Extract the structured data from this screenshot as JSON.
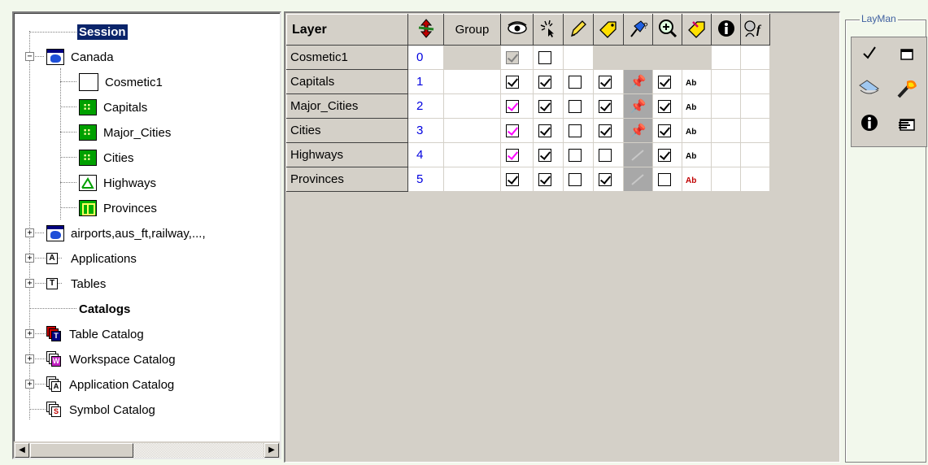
{
  "tree": {
    "nodes": [
      {
        "label": "Session",
        "kind": "session"
      },
      {
        "label": "Canada",
        "kind": "workspace"
      },
      {
        "label": "Cosmetic1",
        "kind": "cosmetic-layer"
      },
      {
        "label": "Capitals",
        "kind": "point-layer"
      },
      {
        "label": "Major_Cities",
        "kind": "point-layer"
      },
      {
        "label": "Cities",
        "kind": "point-layer"
      },
      {
        "label": "Highways",
        "kind": "line-layer"
      },
      {
        "label": "Provinces",
        "kind": "polygon-layer"
      },
      {
        "label": "airports,aus_ft,railway,...,",
        "kind": "workspace"
      },
      {
        "label": "Applications",
        "kind": "applications"
      },
      {
        "label": "Tables",
        "kind": "tables"
      },
      {
        "label": "Catalogs",
        "kind": "heading"
      },
      {
        "label": "Table Catalog",
        "kind": "catalog",
        "letter": "T"
      },
      {
        "label": "Workspace Catalog",
        "kind": "catalog",
        "letter": "W"
      },
      {
        "label": "Application Catalog",
        "kind": "catalog",
        "letter": "A"
      },
      {
        "label": "Symbol Catalog",
        "kind": "catalog",
        "letter": "S"
      }
    ],
    "glyphs": {
      "collapse": "−",
      "expand": "+",
      "app_letter": "A",
      "table_letter": "T"
    },
    "scroll": {
      "left": "◀",
      "right": "▶"
    }
  },
  "grid": {
    "header": {
      "layer": "Layer",
      "group": "Group",
      "icons": [
        "reorder-icon",
        "group-icon",
        "visible-eye-icon",
        "selectable-cursor-icon",
        "editable-pencil-icon",
        "labels-tag-icon",
        "hotlink-pin-icon",
        "zoom-layer-icon",
        "autolabel-icon",
        "info-icon",
        "thematic-function-icon"
      ]
    },
    "rows": [
      {
        "name": "Cosmetic1",
        "index": "0",
        "visible": "disabled-on",
        "selectable": "off"
      },
      {
        "name": "Capitals",
        "index": "1",
        "visible": "on",
        "selectable": "on",
        "editable": "off",
        "labels": "on",
        "hotlink": "yes",
        "zoom": "on",
        "label_style": "Ab"
      },
      {
        "name": "Major_Cities",
        "index": "2",
        "visible": "pink",
        "selectable": "on",
        "editable": "off",
        "labels": "on",
        "hotlink": "yes",
        "zoom": "on",
        "label_style": "Ab"
      },
      {
        "name": "Cities",
        "index": "3",
        "visible": "pink",
        "selectable": "on",
        "editable": "off",
        "labels": "on",
        "hotlink": "yes",
        "zoom": "on",
        "label_style": "Ab"
      },
      {
        "name": "Highways",
        "index": "4",
        "visible": "pink",
        "selectable": "on",
        "editable": "off",
        "labels": "off",
        "hotlink": "no",
        "zoom": "on",
        "label_style": "Ab"
      },
      {
        "name": "Provinces",
        "index": "5",
        "visible": "on",
        "selectable": "on",
        "editable": "off",
        "labels": "on",
        "hotlink": "no",
        "zoom": "off",
        "label_style": "Ab"
      }
    ],
    "colors": {
      "index": "#0000e0",
      "pink_check": "#ff00ff",
      "label_red": "#c00000"
    }
  },
  "layman": {
    "title": "LayMan",
    "tools": [
      "apply-check-icon",
      "window-icon",
      "eraser-icon",
      "torch-icon",
      "info-icon",
      "properties-icon"
    ]
  }
}
